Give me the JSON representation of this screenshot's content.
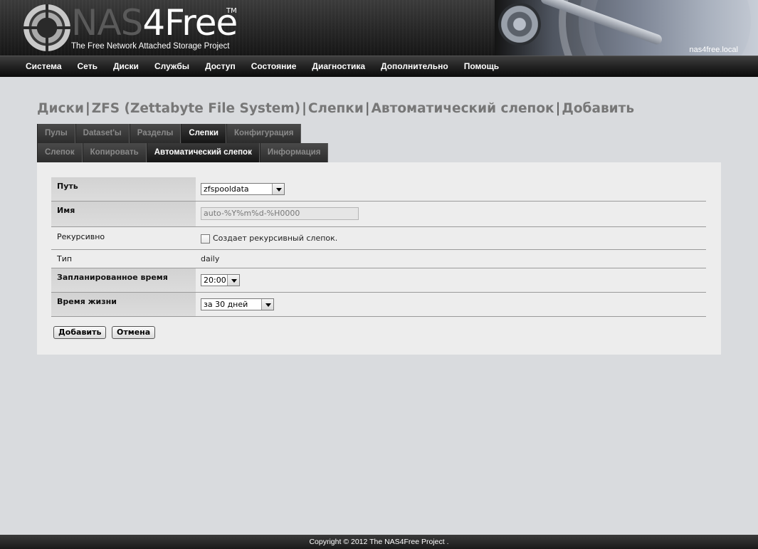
{
  "header": {
    "logo_nas": "NAS",
    "logo_free": "4Free",
    "logo_tm": "TM",
    "tagline": "The Free Network Attached Storage Project",
    "hostname": "nas4free.local"
  },
  "nav": {
    "items": [
      "Система",
      "Сеть",
      "Диски",
      "Службы",
      "Доступ",
      "Состояние",
      "Диагностика",
      "Дополнительно",
      "Помощь"
    ]
  },
  "title": {
    "parts": [
      "Диски",
      "ZFS (Zettabyte File System)",
      "Слепки",
      "Автоматический слепок",
      "Добавить"
    ],
    "separator": "|"
  },
  "tabs_primary": {
    "items": [
      "Пулы",
      "Dataset'ы",
      "Разделы",
      "Слепки",
      "Конфигурация"
    ],
    "active": "Слепки"
  },
  "tabs_secondary": {
    "items": [
      "Слепок",
      "Копировать",
      "Автоматический слепок",
      "Информация"
    ],
    "active": "Автоматический слепок"
  },
  "form": {
    "path": {
      "label": "Путь",
      "value": "zfspooldata"
    },
    "name": {
      "label": "Имя",
      "value": "auto-%Y%m%d-%H0000"
    },
    "recursive": {
      "label": "Рекурсивно",
      "checked": false,
      "description": "Создает рекурсивный слепок."
    },
    "type": {
      "label": "Тип",
      "value": "daily"
    },
    "scheduled_time": {
      "label": "Запланированное время",
      "value": "20:00"
    },
    "lifetime": {
      "label": "Время жизни",
      "value": "за 30 дней"
    }
  },
  "buttons": {
    "add": "Добавить",
    "cancel": "Отмена"
  },
  "footer": {
    "copyright": "Copyright © 2012 The NAS4Free Project ."
  }
}
